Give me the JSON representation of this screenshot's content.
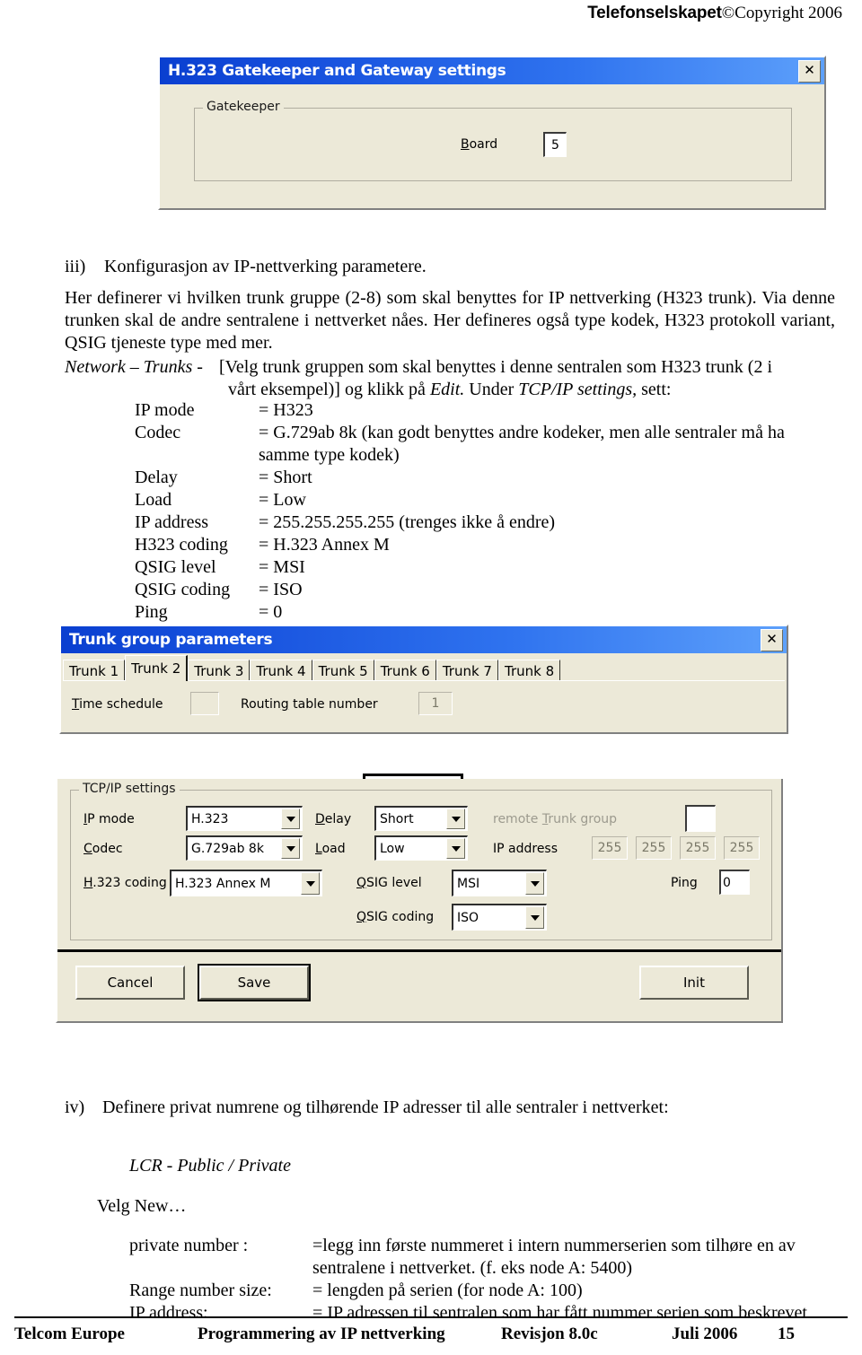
{
  "header": {
    "brand": "Telefonselskapet",
    "copyright": "©Copyright 2006"
  },
  "gatekeeper_dialog": {
    "title": "H.323 Gatekeeper and Gateway settings",
    "close_label": "✕",
    "group_legend": "Gatekeeper",
    "board_label": "Board",
    "board_value": "5"
  },
  "section_iii": {
    "marker": "iii)",
    "heading": "Konfigurasjon av IP-nettverking parametere.",
    "paragraph": "Her definerer vi hvilken trunk gruppe (2-8) som skal benyttes for IP nettverking (H323 trunk).  Via denne trunken skal de andre sentralene i nettverket nåes.  Her defineres også type kodek, H323 protokoll variant, QSIG tjeneste type med mer.",
    "nav_path": "Network – Trunks -",
    "nav_instruction_1": "[Velg trunk gruppen som skal benyttes i denne sentralen som H323 trunk (2 i",
    "nav_instruction_2_a": "vårt eksempel)] og klikk på ",
    "nav_instruction_2_edit": "Edit.",
    "nav_instruction_2_b": " Under ",
    "nav_instruction_2_tcpip": "TCP/IP settings,",
    "nav_instruction_2_c": " sett:",
    "params": [
      {
        "key": "IP mode",
        "value": "= H323"
      },
      {
        "key": "Codec",
        "value": "= G.729ab 8k  (kan godt benyttes andre kodeker, men alle sentraler må ha samme type kodek)"
      },
      {
        "key": "Delay",
        "value": "= Short"
      },
      {
        "key": "Load",
        "value": "= Low"
      },
      {
        "key": "IP address",
        "value": "= 255.255.255.255 (trenges ikke å endre)"
      },
      {
        "key": "H323 coding",
        "value": "= H.323 Annex M"
      },
      {
        "key": "QSIG level",
        "value": "= MSI"
      },
      {
        "key": "QSIG coding",
        "value": "= ISO"
      },
      {
        "key": "Ping",
        "value": "= 0"
      }
    ]
  },
  "trunk_dialog": {
    "title": "Trunk group parameters",
    "close_label": "✕",
    "tabs": [
      {
        "label": "Trunk 1",
        "active": false
      },
      {
        "label": "Trunk 2",
        "active": true
      },
      {
        "label": "Trunk 3",
        "active": false
      },
      {
        "label": "Trunk 4",
        "active": false
      },
      {
        "label": "Trunk 5",
        "active": false
      },
      {
        "label": "Trunk 6",
        "active": false
      },
      {
        "label": "Trunk 7",
        "active": false
      },
      {
        "label": "Trunk 8",
        "active": false
      }
    ],
    "time_schedule_label": "Time schedule",
    "time_schedule_value": "",
    "routing_table_label": "Routing table number",
    "routing_table_value": "1"
  },
  "tcpip_panel": {
    "group_legend": "TCP/IP settings",
    "ip_mode_label": "IP mode",
    "ip_mode_value": "H.323",
    "codec_label": "Codec",
    "codec_value": "G.729ab 8k",
    "h323_coding_label": "H.323 coding",
    "h323_coding_value": "H.323 Annex M",
    "delay_label": "Delay",
    "delay_value": "Short",
    "load_label": "Load",
    "load_value": "Low",
    "qsig_level_label": "QSIG level",
    "qsig_level_value": "MSI",
    "qsig_coding_label": "QSIG coding",
    "qsig_coding_value": "ISO",
    "remote_trunk_group_label": "remote Trunk group",
    "remote_trunk_group_value": "",
    "ip_address_label": "IP address",
    "ip_address_octets": [
      "255",
      "255",
      "255",
      "255"
    ],
    "ping_label": "Ping",
    "ping_value": "0",
    "cancel_label": "Cancel",
    "save_label": "Save",
    "init_label": "Init"
  },
  "section_iv": {
    "marker": "iv)",
    "heading": "Definere privat numrene og tilhørende IP adresser til alle sentraler i nettverket:",
    "lcr_path": "LCR  - Public / Private",
    "velg_new": "Velg  New…",
    "rows": [
      {
        "key": "private number :",
        "value": "=legg inn første nummeret i intern nummerserien som tilhøre en av sentralene i nettverket. (f. eks node A: 5400)"
      },
      {
        "key": "Range number size:",
        "value": "= lengden på serien (for node A: 100)"
      },
      {
        "key": "IP address:",
        "value": "= IP adressen til sentralen som har fått nummer serien som beskrevet"
      }
    ]
  },
  "footer": {
    "company": "Telcom Europe",
    "doc_title": "Programmering av IP nettverking",
    "revision": "Revisjon 8.0c",
    "date": "Juli 2006",
    "page": "15"
  }
}
